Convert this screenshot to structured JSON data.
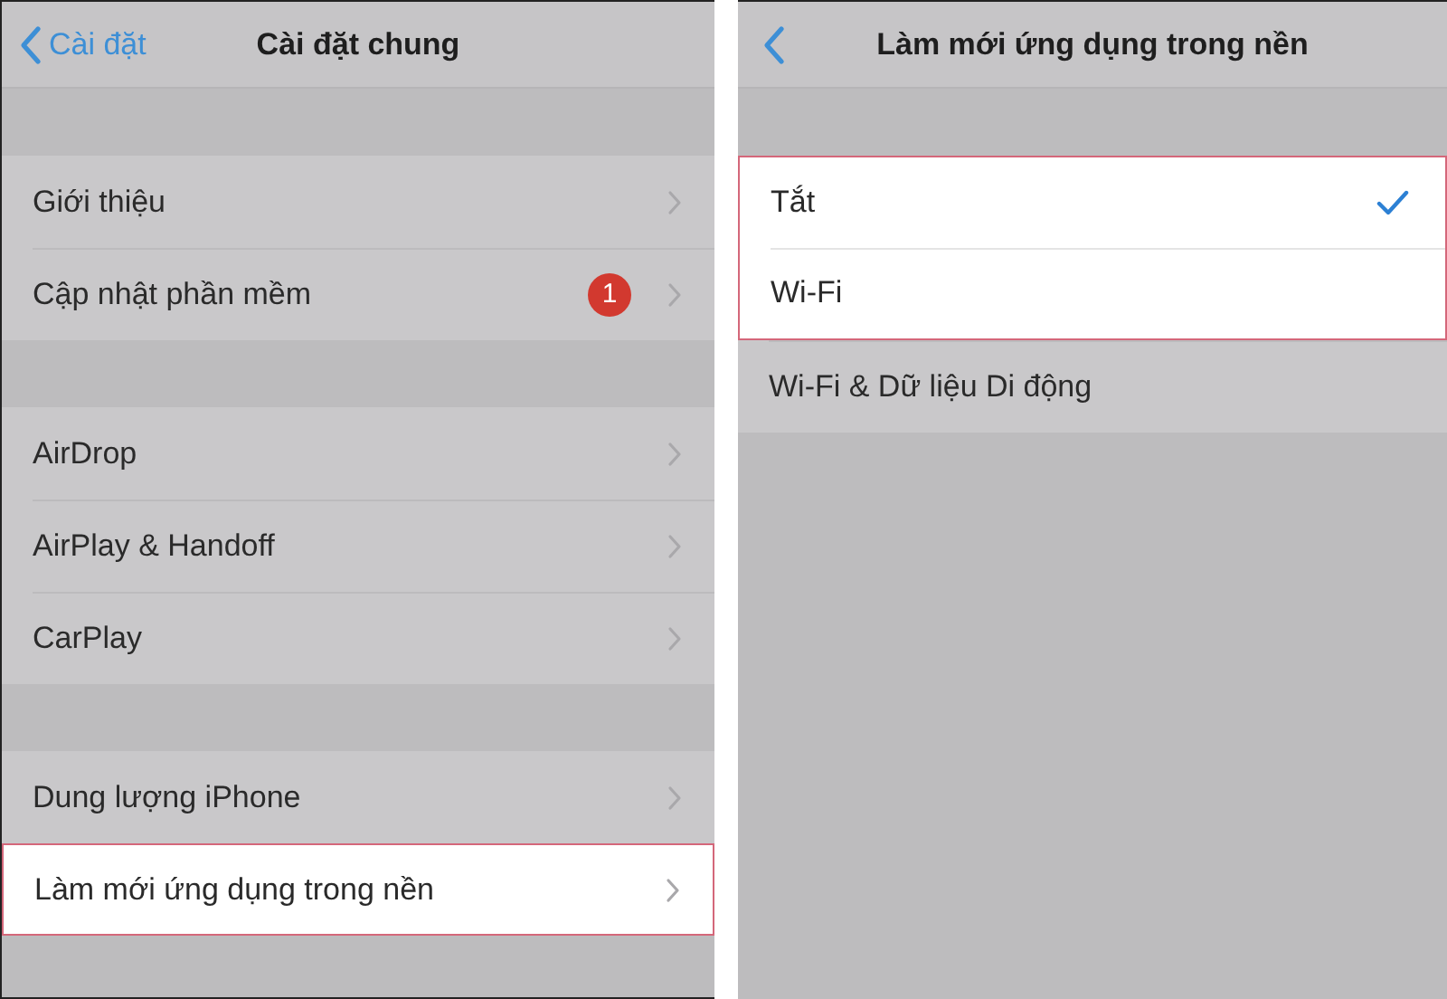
{
  "left_screen": {
    "back_button": "Cài đặt",
    "title": "Cài đặt chung",
    "groups": [
      {
        "items": [
          {
            "label": "Giới thiệu",
            "highlighted": false
          },
          {
            "label": "Cập nhật phần mềm",
            "badge": "1",
            "highlighted": false
          }
        ]
      },
      {
        "items": [
          {
            "label": "AirDrop",
            "highlighted": false
          },
          {
            "label": "AirPlay & Handoff",
            "highlighted": false
          },
          {
            "label": "CarPlay",
            "highlighted": false
          }
        ]
      },
      {
        "items": [
          {
            "label": "Dung lượng iPhone",
            "highlighted": false
          },
          {
            "label": "Làm mới ứng dụng trong nền",
            "highlighted": true
          }
        ]
      }
    ]
  },
  "right_screen": {
    "title": "Làm mới ứng dụng trong nền",
    "options": [
      {
        "label": "Tắt",
        "selected": true,
        "highlighted": true
      },
      {
        "label": "Wi-Fi",
        "selected": false,
        "highlighted": true
      },
      {
        "label": "Wi-Fi & Dữ liệu Di động",
        "selected": false,
        "highlighted": false
      }
    ]
  }
}
